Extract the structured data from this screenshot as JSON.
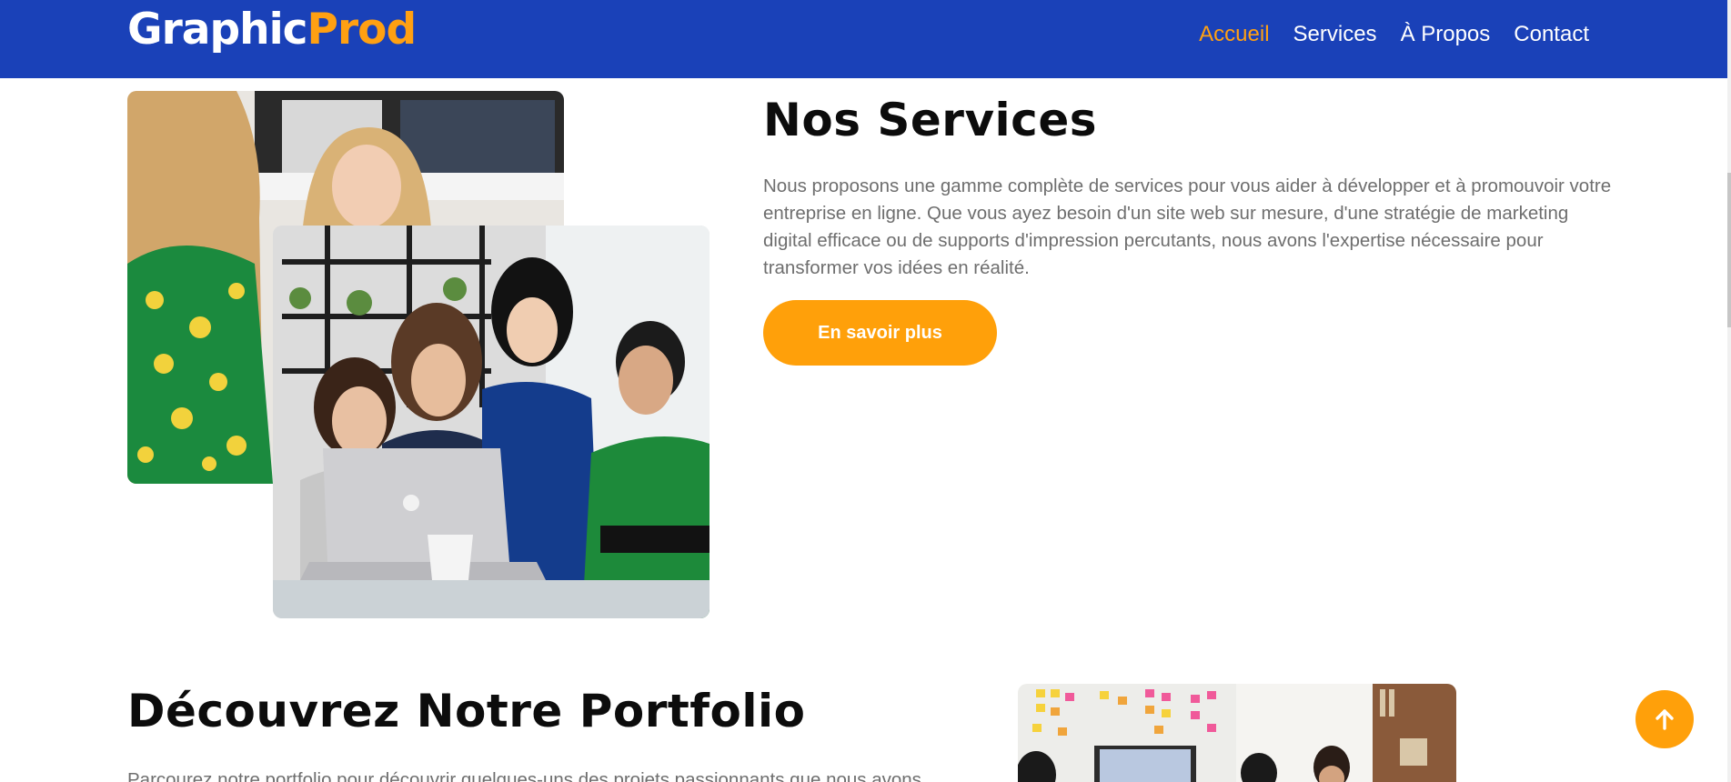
{
  "header": {
    "logo_part1": "Graphic",
    "logo_part2": "Prod",
    "nav": [
      "Accueil",
      "Services",
      "À Propos",
      "Contact"
    ],
    "active_nav": "Accueil"
  },
  "services": {
    "title": "Nos Services",
    "text": "Nous proposons une gamme complète de services pour vous aider à développer et à promouvoir votre entreprise en ligne. Que vous ayez besoin d'un site web sur mesure, d'une stratégie de marketing digital efficace ou de supports d'impression percutants, nous avons l'expertise nécessaire pour transformer vos idées en réalité.",
    "button": "En savoir plus"
  },
  "portfolio": {
    "title": "Découvrez Notre Portfolio",
    "text": "Parcourez notre portfolio pour découvrir quelques-uns des projets passionnants que nous avons"
  },
  "icons": {
    "scroll_top": "arrow-up-icon"
  },
  "colors": {
    "header_bg": "#1a41b8",
    "accent": "#ffa012",
    "heading": "#0c0c0c",
    "body_text": "#6e6e6e"
  }
}
